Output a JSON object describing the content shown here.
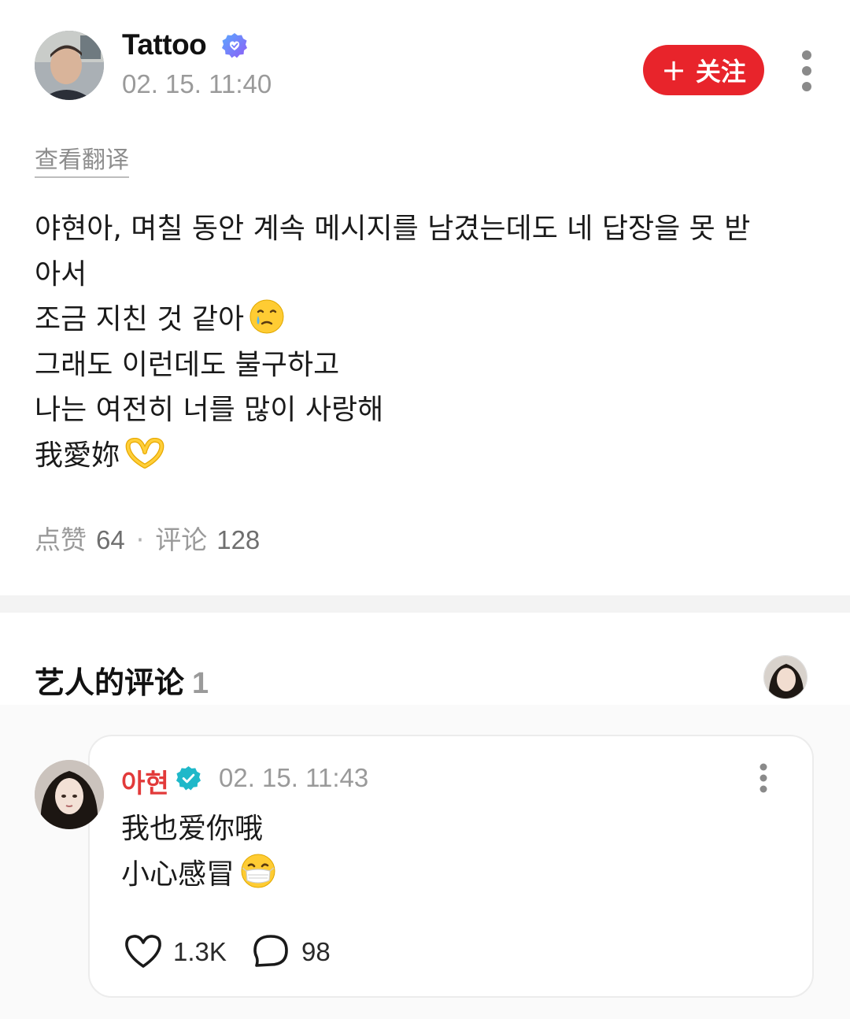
{
  "post": {
    "author": "Tattoo",
    "timestamp": "02. 15. 11:40",
    "follow_label": "关注",
    "translate_label": "查看翻译",
    "body_lines": [
      "야현아, 며칠 동안 계속 메시지를 남겼는데도 네 답장을 못 받",
      "아서",
      "조금 지친 것 같아",
      "그래도 이런데도 불구하고",
      "나는 여전히 너를 많이 사랑해",
      "我愛妳"
    ],
    "likes_label": "点赞",
    "likes_count": "64",
    "comments_label": "评论",
    "comments_count": "128"
  },
  "artist_comments": {
    "title": "艺人的评论",
    "count": "1",
    "comment": {
      "author": "아현",
      "timestamp": "02. 15. 11:43",
      "body_lines": [
        "我也爱你哦",
        "小心感冒"
      ],
      "likes": "1.3K",
      "replies": "98"
    }
  },
  "colors": {
    "follow_button": "#e8242b",
    "artist_name": "#e23a3a",
    "verified_purple": "#7b6cf6",
    "verified_teal": "#1fb8c9"
  },
  "icons": [
    "verified-badge-icon",
    "plus-icon",
    "more-vertical-icon",
    "sad-tear-emoji-icon",
    "heart-hands-emoji-icon",
    "mask-emoji-icon",
    "heart-icon",
    "comment-bubble-icon"
  ]
}
